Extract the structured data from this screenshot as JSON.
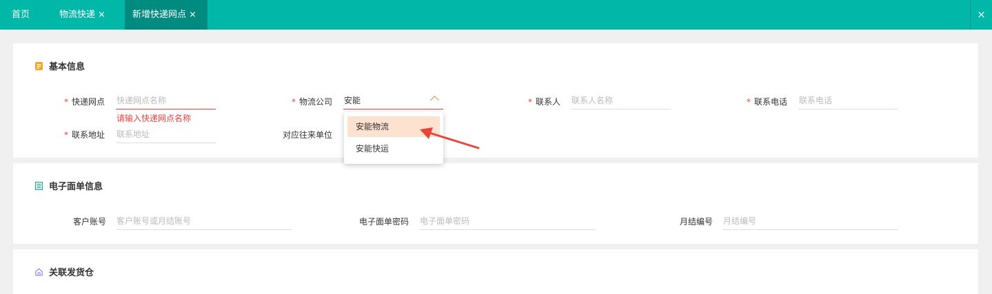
{
  "tabs": {
    "home": "首页",
    "logistics": "物流快递",
    "new_outlet": "新增快递网点",
    "close_glyph": "×"
  },
  "basic_info": {
    "title": "基本信息",
    "outlet_label": "快递网点",
    "outlet_placeholder": "快递网点名称",
    "outlet_error": "请输入快递网点名称",
    "company_label": "物流公司",
    "company_value": "安能",
    "contact_label": "联系人",
    "contact_placeholder": "联系人名称",
    "phone_label": "联系电话",
    "phone_placeholder": "联系电话",
    "address_label": "联系地址",
    "address_placeholder": "联系地址",
    "partner_label": "对应往来单位",
    "required_mark": "*"
  },
  "company_dropdown": {
    "options": [
      "安能物流",
      "安能快运"
    ],
    "highlighted": "安能物流"
  },
  "waybill_info": {
    "title": "电子面单信息",
    "account_label": "客户账号",
    "account_placeholder": "客户账号或月结账号",
    "password_label": "电子面单密码",
    "password_placeholder": "电子面单密码",
    "monthly_label": "月结编号",
    "monthly_placeholder": "月结编号"
  },
  "warehouse": {
    "title": "关联发货仓"
  },
  "colors": {
    "header": "#00b7a8",
    "active_tab": "#008b80",
    "error": "#e64340",
    "dropdown_hover": "#fde2cf",
    "icon_orange": "#f5a623",
    "icon_green": "#26a69a",
    "icon_purple": "#8c7ae6"
  }
}
